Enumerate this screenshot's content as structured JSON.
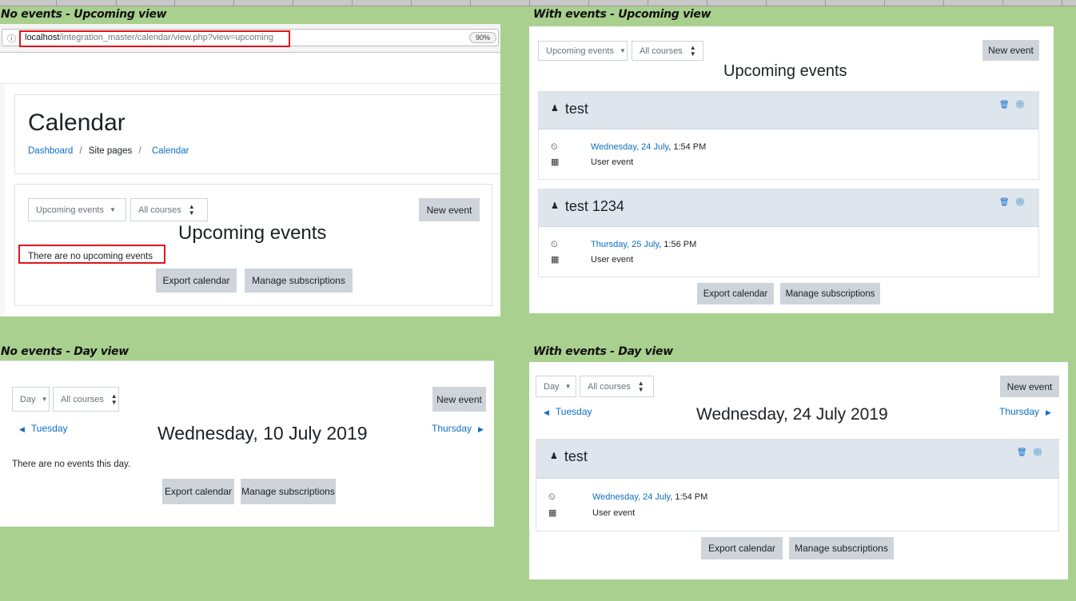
{
  "labels": {
    "nu": "No events - Upcoming view",
    "wu": "With events - Upcoming view",
    "nd": "No events - Day view",
    "wd": "With events - Day view"
  },
  "browser": {
    "url_host": "localhost",
    "url_path": "/integration_master/calendar/view.php?view=upcoming",
    "zoom": "90%"
  },
  "common": {
    "upcoming_select": "Upcoming events",
    "day_select": "Day",
    "courses_select": "All courses",
    "new_event": "New event",
    "export": "Export calendar",
    "manage": "Manage subscriptions",
    "upcoming_heading": "Upcoming events",
    "user_event": "User event"
  },
  "nu": {
    "page_title": "Calendar",
    "breadcrumb": [
      "Dashboard",
      "Site pages",
      "Calendar"
    ],
    "empty_message": "There are no upcoming events"
  },
  "wu": {
    "events": [
      {
        "title": "test",
        "date_link": "Wednesday, 24 July",
        "time": ", 1:54 PM",
        "type": "User event"
      },
      {
        "title": "test 1234",
        "date_link": "Thursday, 25 July",
        "time": ", 1:56 PM",
        "type": "User event"
      }
    ]
  },
  "nd": {
    "prev": "Tuesday",
    "next": "Thursday",
    "date_heading": "Wednesday, 10 July 2019",
    "empty_message": "There are no events this day."
  },
  "wd": {
    "prev": "Tuesday",
    "next": "Thursday",
    "date_heading": "Wednesday, 24 July 2019",
    "event": {
      "title": "test",
      "date_link": "Wednesday, 24 July",
      "time": ", 1:54 PM",
      "type": "User event"
    }
  },
  "colors": {
    "background": "#a9d08e",
    "link": "#0f6fc5",
    "button": "#ced4da",
    "card_header": "#dee5ec",
    "highlight": "#e0161b"
  }
}
